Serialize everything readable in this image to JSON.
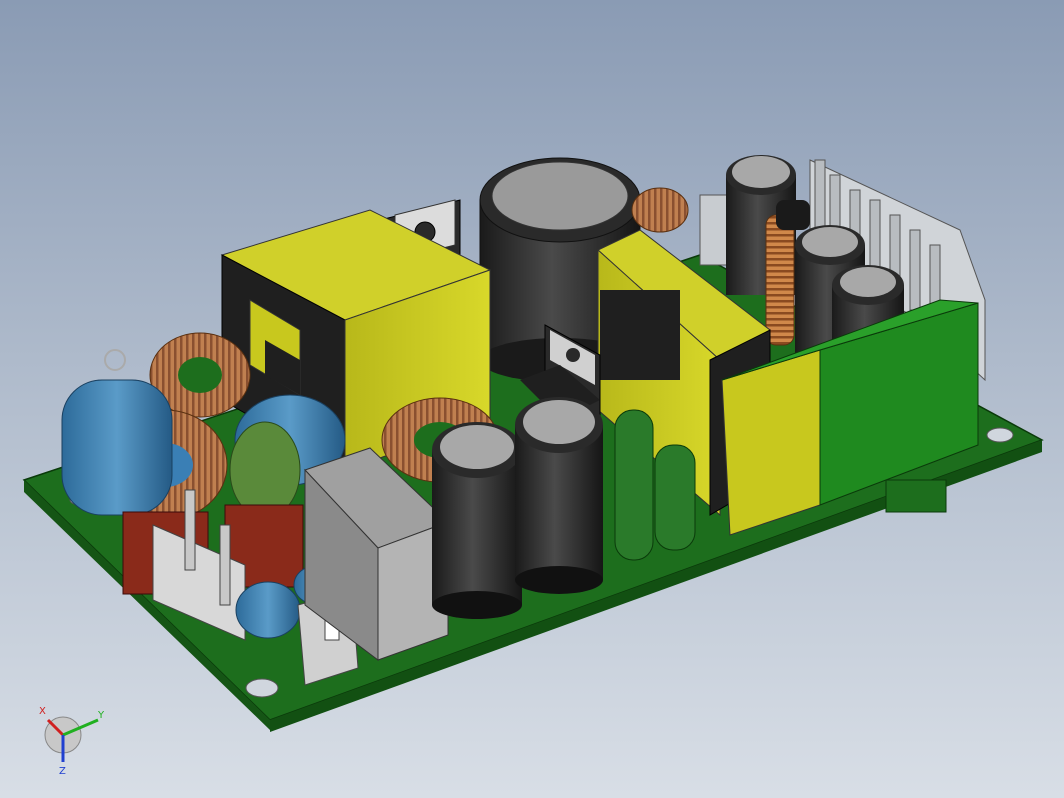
{
  "viewport": {
    "model": "smps_power_supply_board_assembly",
    "background_top": "#8a9bb4",
    "background_bottom": "#d8dee6"
  },
  "triad": {
    "x_label": "X",
    "y_label": "Y",
    "z_label": "Z",
    "x_color": "#d02020",
    "y_color": "#20b020",
    "z_color": "#2040d0"
  },
  "colors": {
    "pcb": "#1f7a1f",
    "transformer": "#c8c81e",
    "capacitor": "#2a2a2a",
    "film_cap": "#3a7fb5",
    "copper": "#b87333",
    "heatsink": "#c0c0c0"
  }
}
